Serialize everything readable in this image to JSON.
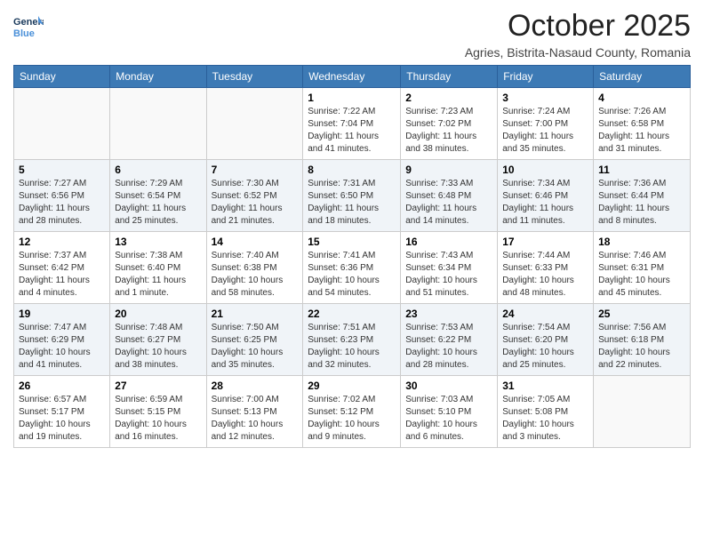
{
  "header": {
    "logo_line1": "General",
    "logo_line2": "Blue",
    "month_title": "October 2025",
    "location": "Agries, Bistrita-Nasaud County, Romania"
  },
  "days_of_week": [
    "Sunday",
    "Monday",
    "Tuesday",
    "Wednesday",
    "Thursday",
    "Friday",
    "Saturday"
  ],
  "weeks": [
    [
      {
        "day": "",
        "info": ""
      },
      {
        "day": "",
        "info": ""
      },
      {
        "day": "",
        "info": ""
      },
      {
        "day": "1",
        "info": "Sunrise: 7:22 AM\nSunset: 7:04 PM\nDaylight: 11 hours\nand 41 minutes."
      },
      {
        "day": "2",
        "info": "Sunrise: 7:23 AM\nSunset: 7:02 PM\nDaylight: 11 hours\nand 38 minutes."
      },
      {
        "day": "3",
        "info": "Sunrise: 7:24 AM\nSunset: 7:00 PM\nDaylight: 11 hours\nand 35 minutes."
      },
      {
        "day": "4",
        "info": "Sunrise: 7:26 AM\nSunset: 6:58 PM\nDaylight: 11 hours\nand 31 minutes."
      }
    ],
    [
      {
        "day": "5",
        "info": "Sunrise: 7:27 AM\nSunset: 6:56 PM\nDaylight: 11 hours\nand 28 minutes."
      },
      {
        "day": "6",
        "info": "Sunrise: 7:29 AM\nSunset: 6:54 PM\nDaylight: 11 hours\nand 25 minutes."
      },
      {
        "day": "7",
        "info": "Sunrise: 7:30 AM\nSunset: 6:52 PM\nDaylight: 11 hours\nand 21 minutes."
      },
      {
        "day": "8",
        "info": "Sunrise: 7:31 AM\nSunset: 6:50 PM\nDaylight: 11 hours\nand 18 minutes."
      },
      {
        "day": "9",
        "info": "Sunrise: 7:33 AM\nSunset: 6:48 PM\nDaylight: 11 hours\nand 14 minutes."
      },
      {
        "day": "10",
        "info": "Sunrise: 7:34 AM\nSunset: 6:46 PM\nDaylight: 11 hours\nand 11 minutes."
      },
      {
        "day": "11",
        "info": "Sunrise: 7:36 AM\nSunset: 6:44 PM\nDaylight: 11 hours\nand 8 minutes."
      }
    ],
    [
      {
        "day": "12",
        "info": "Sunrise: 7:37 AM\nSunset: 6:42 PM\nDaylight: 11 hours\nand 4 minutes."
      },
      {
        "day": "13",
        "info": "Sunrise: 7:38 AM\nSunset: 6:40 PM\nDaylight: 11 hours\nand 1 minute."
      },
      {
        "day": "14",
        "info": "Sunrise: 7:40 AM\nSunset: 6:38 PM\nDaylight: 10 hours\nand 58 minutes."
      },
      {
        "day": "15",
        "info": "Sunrise: 7:41 AM\nSunset: 6:36 PM\nDaylight: 10 hours\nand 54 minutes."
      },
      {
        "day": "16",
        "info": "Sunrise: 7:43 AM\nSunset: 6:34 PM\nDaylight: 10 hours\nand 51 minutes."
      },
      {
        "day": "17",
        "info": "Sunrise: 7:44 AM\nSunset: 6:33 PM\nDaylight: 10 hours\nand 48 minutes."
      },
      {
        "day": "18",
        "info": "Sunrise: 7:46 AM\nSunset: 6:31 PM\nDaylight: 10 hours\nand 45 minutes."
      }
    ],
    [
      {
        "day": "19",
        "info": "Sunrise: 7:47 AM\nSunset: 6:29 PM\nDaylight: 10 hours\nand 41 minutes."
      },
      {
        "day": "20",
        "info": "Sunrise: 7:48 AM\nSunset: 6:27 PM\nDaylight: 10 hours\nand 38 minutes."
      },
      {
        "day": "21",
        "info": "Sunrise: 7:50 AM\nSunset: 6:25 PM\nDaylight: 10 hours\nand 35 minutes."
      },
      {
        "day": "22",
        "info": "Sunrise: 7:51 AM\nSunset: 6:23 PM\nDaylight: 10 hours\nand 32 minutes."
      },
      {
        "day": "23",
        "info": "Sunrise: 7:53 AM\nSunset: 6:22 PM\nDaylight: 10 hours\nand 28 minutes."
      },
      {
        "day": "24",
        "info": "Sunrise: 7:54 AM\nSunset: 6:20 PM\nDaylight: 10 hours\nand 25 minutes."
      },
      {
        "day": "25",
        "info": "Sunrise: 7:56 AM\nSunset: 6:18 PM\nDaylight: 10 hours\nand 22 minutes."
      }
    ],
    [
      {
        "day": "26",
        "info": "Sunrise: 6:57 AM\nSunset: 5:17 PM\nDaylight: 10 hours\nand 19 minutes."
      },
      {
        "day": "27",
        "info": "Sunrise: 6:59 AM\nSunset: 5:15 PM\nDaylight: 10 hours\nand 16 minutes."
      },
      {
        "day": "28",
        "info": "Sunrise: 7:00 AM\nSunset: 5:13 PM\nDaylight: 10 hours\nand 12 minutes."
      },
      {
        "day": "29",
        "info": "Sunrise: 7:02 AM\nSunset: 5:12 PM\nDaylight: 10 hours\nand 9 minutes."
      },
      {
        "day": "30",
        "info": "Sunrise: 7:03 AM\nSunset: 5:10 PM\nDaylight: 10 hours\nand 6 minutes."
      },
      {
        "day": "31",
        "info": "Sunrise: 7:05 AM\nSunset: 5:08 PM\nDaylight: 10 hours\nand 3 minutes."
      },
      {
        "day": "",
        "info": ""
      }
    ]
  ]
}
